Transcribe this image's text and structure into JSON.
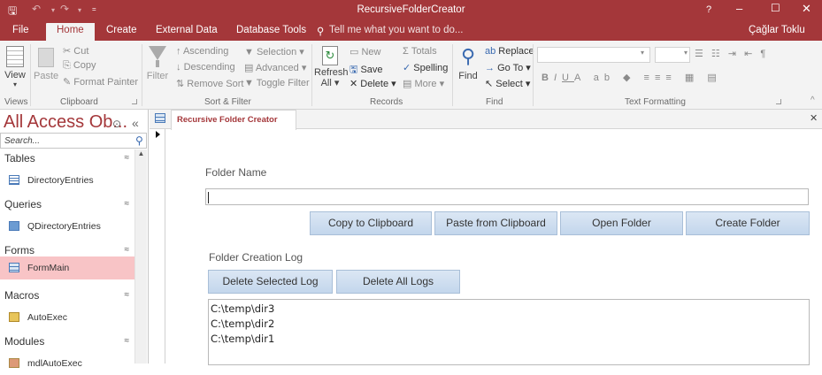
{
  "window": {
    "title": "RecursiveFolderCreator",
    "help_glyph": "?",
    "user": "Çağlar Toklu"
  },
  "ribbon_tabs": [
    "File",
    "Home",
    "Create",
    "External Data",
    "Database Tools"
  ],
  "tell_me": "Tell me what you want to do...",
  "ribbon": {
    "views": {
      "view_label": "View",
      "group": "Views"
    },
    "clipboard": {
      "paste": "Paste",
      "cut": "Cut",
      "copy": "Copy",
      "format_painter": "Format Painter",
      "group": "Clipboard"
    },
    "sort_filter": {
      "filter": "Filter",
      "ascending": "Ascending",
      "descending": "Descending",
      "remove_sort": "Remove Sort",
      "selection": "Selection",
      "advanced": "Advanced",
      "toggle_filter": "Toggle Filter",
      "group": "Sort & Filter"
    },
    "records": {
      "refresh_all": "Refresh",
      "refresh_all2": "All",
      "new": "New",
      "save": "Save",
      "delete": "Delete",
      "totals": "Totals",
      "spelling": "Spelling",
      "more": "More",
      "group": "Records"
    },
    "find": {
      "find": "Find",
      "replace": "Replace",
      "go_to": "Go To",
      "select": "Select",
      "group": "Find"
    },
    "text_formatting": {
      "group": "Text Formatting"
    }
  },
  "nav": {
    "title": "All Access Ob...",
    "search_placeholder": "Search...",
    "categories": [
      {
        "label": "Tables",
        "items": [
          "DirectoryEntries"
        ]
      },
      {
        "label": "Queries",
        "items": [
          "QDirectoryEntries"
        ]
      },
      {
        "label": "Forms",
        "items": [
          "FormMain"
        ]
      },
      {
        "label": "Macros",
        "items": [
          "AutoExec"
        ]
      },
      {
        "label": "Modules",
        "items": [
          "mdlAutoExec"
        ]
      }
    ]
  },
  "document": {
    "tab_label": "Recursive Folder Creator",
    "folder_name_label": "Folder Name",
    "folder_name_value": "",
    "buttons": {
      "copy": "Copy to Clipboard",
      "paste": "Paste from Clipboard",
      "open": "Open Folder",
      "create": "Create Folder",
      "delete_selected": "Delete Selected Log",
      "delete_all": "Delete All Logs"
    },
    "log_label": "Folder Creation Log",
    "log_entries": [
      "C:\\temp\\dir3",
      "C:\\temp\\dir2",
      "C:\\temp\\dir1"
    ]
  },
  "colors": {
    "accent": "#a4373a",
    "selected_item": "#f8c4c6",
    "button_top": "#dbe7f4",
    "button_bottom": "#c3d6ec"
  }
}
